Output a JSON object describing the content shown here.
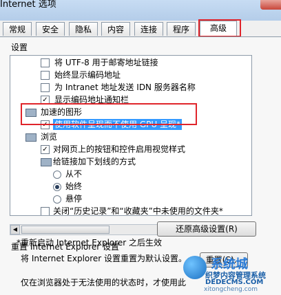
{
  "window": {
    "title": "Internet 选项"
  },
  "tabs": [
    "常规",
    "安全",
    "隐私",
    "内容",
    "连接",
    "程序",
    "高级"
  ],
  "settings": {
    "group_label": "设置",
    "items": [
      "将 UTF-8 用于邮寄地址链接",
      "始终显示编码地址",
      "为 Intranet 地址发送 IDN 服务器名称",
      "显示编码地址通知栏",
      "加速的图形",
      "使用软件呈现而不使用 GPU 呈现*",
      "浏览",
      "对网页上的按钮和控件启用视觉样式",
      "给链接加下划线的方式",
      "从不",
      "始终",
      "悬停",
      "关闭“历史记录”和“收藏夹”中未使用的文件夹*"
    ]
  },
  "note": "*重新启动 Internet Explorer 之后生效",
  "restore_button": "还原高级设置(R)",
  "reset": {
    "section_title": "重置 Internet Explorer 设置",
    "description": "将 Internet Explorer 设置重置为默认设置。",
    "button": "重置(S)...",
    "footer": "仅在浏览器处于无法使用的状态时，才使用此"
  },
  "watermark": {
    "brand": "系统城",
    "line1": "织梦内容管理系统",
    "line2": "DEDECMS.COM",
    "line3": "xitongcheng.com"
  }
}
